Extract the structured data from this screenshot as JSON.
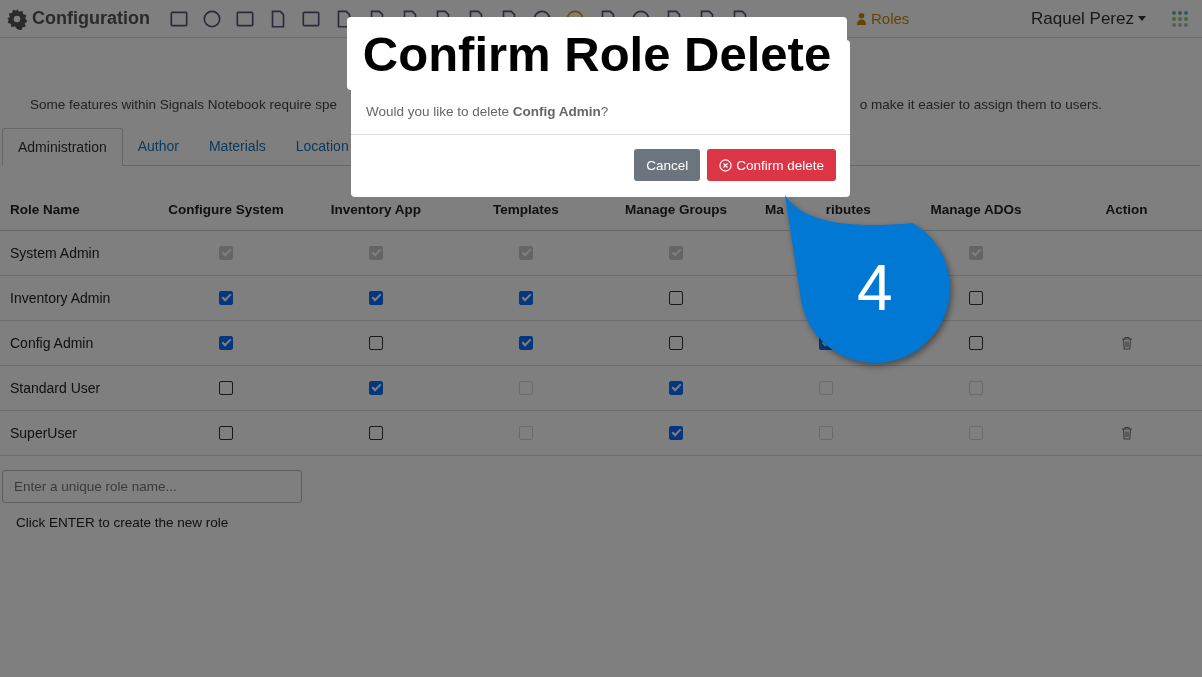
{
  "header": {
    "title": "Configuration",
    "breadcrumb": "Roles",
    "user": "Raquel Perez"
  },
  "intro": {
    "parts": [
      "Some features within Signals Notebook require spe",
      "o make it easier to assign them to users."
    ]
  },
  "tabs": [
    {
      "label": "Administration",
      "selected": true
    },
    {
      "label": "Author",
      "selected": false
    },
    {
      "label": "Materials",
      "selected": false
    },
    {
      "label": "Location",
      "selected": false
    }
  ],
  "table": {
    "columns": [
      "Role Name",
      "Configure System",
      "Inventory App",
      "Templates",
      "Manage Groups",
      [
        "Ma",
        "ributes"
      ],
      "Manage ADOs",
      "Action"
    ],
    "rows": [
      {
        "name": "System Admin",
        "deletable": false,
        "cells": [
          {
            "checked": true,
            "disabled": true
          },
          {
            "checked": true,
            "disabled": true
          },
          {
            "checked": true,
            "disabled": true
          },
          {
            "checked": true,
            "disabled": true
          },
          null,
          {
            "checked": true,
            "disabled": true
          }
        ]
      },
      {
        "name": "Inventory Admin",
        "deletable": false,
        "cells": [
          {
            "checked": true,
            "disabled": false
          },
          {
            "checked": true,
            "disabled": false
          },
          {
            "checked": true,
            "disabled": false
          },
          {
            "checked": false,
            "disabled": false
          },
          null,
          {
            "checked": false,
            "disabled": false
          }
        ]
      },
      {
        "name": "Config Admin",
        "deletable": true,
        "cells": [
          {
            "checked": true,
            "disabled": false
          },
          {
            "checked": false,
            "disabled": false
          },
          {
            "checked": true,
            "disabled": false
          },
          {
            "checked": false,
            "disabled": false
          },
          {
            "checked": true,
            "disabled": false
          },
          {
            "checked": false,
            "disabled": false
          }
        ]
      },
      {
        "name": "Standard User",
        "deletable": false,
        "cells": [
          {
            "checked": false,
            "disabled": false
          },
          {
            "checked": true,
            "disabled": false
          },
          {
            "checked": false,
            "disabled": true
          },
          {
            "checked": true,
            "disabled": false
          },
          {
            "checked": false,
            "disabled": true
          },
          {
            "checked": false,
            "disabled": true
          }
        ]
      },
      {
        "name": "SuperUser",
        "deletable": true,
        "cells": [
          {
            "checked": false,
            "disabled": false
          },
          {
            "checked": false,
            "disabled": false
          },
          {
            "checked": false,
            "disabled": true
          },
          {
            "checked": true,
            "disabled": false
          },
          {
            "checked": false,
            "disabled": true
          },
          {
            "checked": false,
            "disabled": true
          }
        ]
      }
    ]
  },
  "new_role": {
    "placeholder": "Enter a unique role name...",
    "hint": "Click ENTER to create the new role"
  },
  "dialog": {
    "title": "Confirm Role Delete",
    "message": "Would you like to delete **Config Admin**?",
    "buttons": [
      {
        "label": "Cancel",
        "kind": "secondary"
      },
      {
        "label": "Confirm delete",
        "kind": "danger"
      }
    ]
  },
  "callout": {
    "number": "4"
  }
}
